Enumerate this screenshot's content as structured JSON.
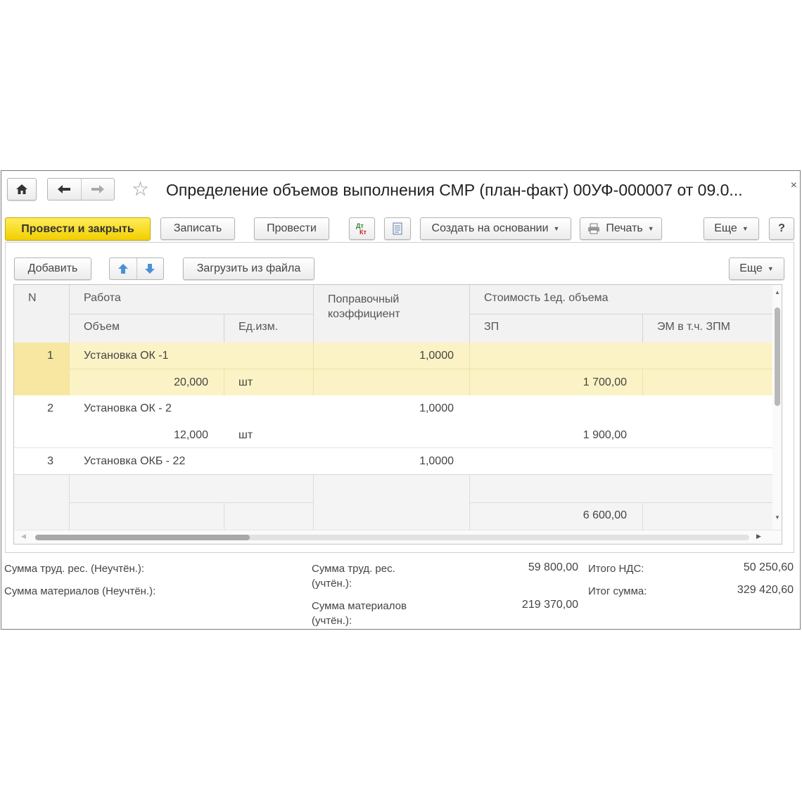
{
  "window": {
    "title": "Определение объемов выполнения СМР (план-факт) 00УФ-000007 от 09.0...",
    "close_glyph": "×"
  },
  "nav": {
    "home_icon": "home-icon",
    "back_icon": "arrow-left-icon",
    "forward_icon": "arrow-right-icon",
    "star_icon": "star-icon"
  },
  "toolbar": {
    "post_close": "Провести и закрыть",
    "save": "Записать",
    "post": "Провести",
    "create_based": "Создать на основании",
    "print": "Печать",
    "more": "Еще",
    "help": "?"
  },
  "table_toolbar": {
    "add": "Добавить",
    "load_file": "Загрузить из файла",
    "more": "Еще"
  },
  "table": {
    "headers": {
      "n": "N",
      "work": "Работа",
      "volume": "Объем",
      "unit": "Ед.изм.",
      "coef": "Поправочный коэффициент",
      "cost": "Стоимость 1ед. объема",
      "zp": "ЗП",
      "em": "ЭМ в т.ч. ЗПМ"
    },
    "rows": [
      {
        "n": "1",
        "work": "Установка ОК -1",
        "coef": "1,0000",
        "volume": "20,000",
        "unit": "шт",
        "zp": "1 700,00"
      },
      {
        "n": "2",
        "work": "Установка ОК - 2",
        "coef": "1,0000",
        "volume": "12,000",
        "unit": "шт",
        "zp": "1 900,00"
      },
      {
        "n": "3",
        "work": "Установка ОКБ - 22",
        "coef": "1,0000",
        "volume": "",
        "unit": "",
        "zp": ""
      }
    ],
    "partial_row_zp": "6 600,00"
  },
  "footer": {
    "labor_unaccounted_label": "Сумма труд. рес. (Неучтён.):",
    "materials_unaccounted_label": "Сумма материалов (Неучтён.):",
    "labor_accounted_label": "Сумма труд. рес. (учтён.):",
    "labor_accounted_value": "59 800,00",
    "materials_accounted_label": "Сумма материалов (учтён.):",
    "materials_accounted_value": "219 370,00",
    "vat_label": "Итого НДС:",
    "vat_value": "50 250,60",
    "total_label": "Итог сумма:",
    "total_value": "329 420,60"
  },
  "colors": {
    "selected_row": "#fbf3c5",
    "primary_button": "#f5d400"
  }
}
